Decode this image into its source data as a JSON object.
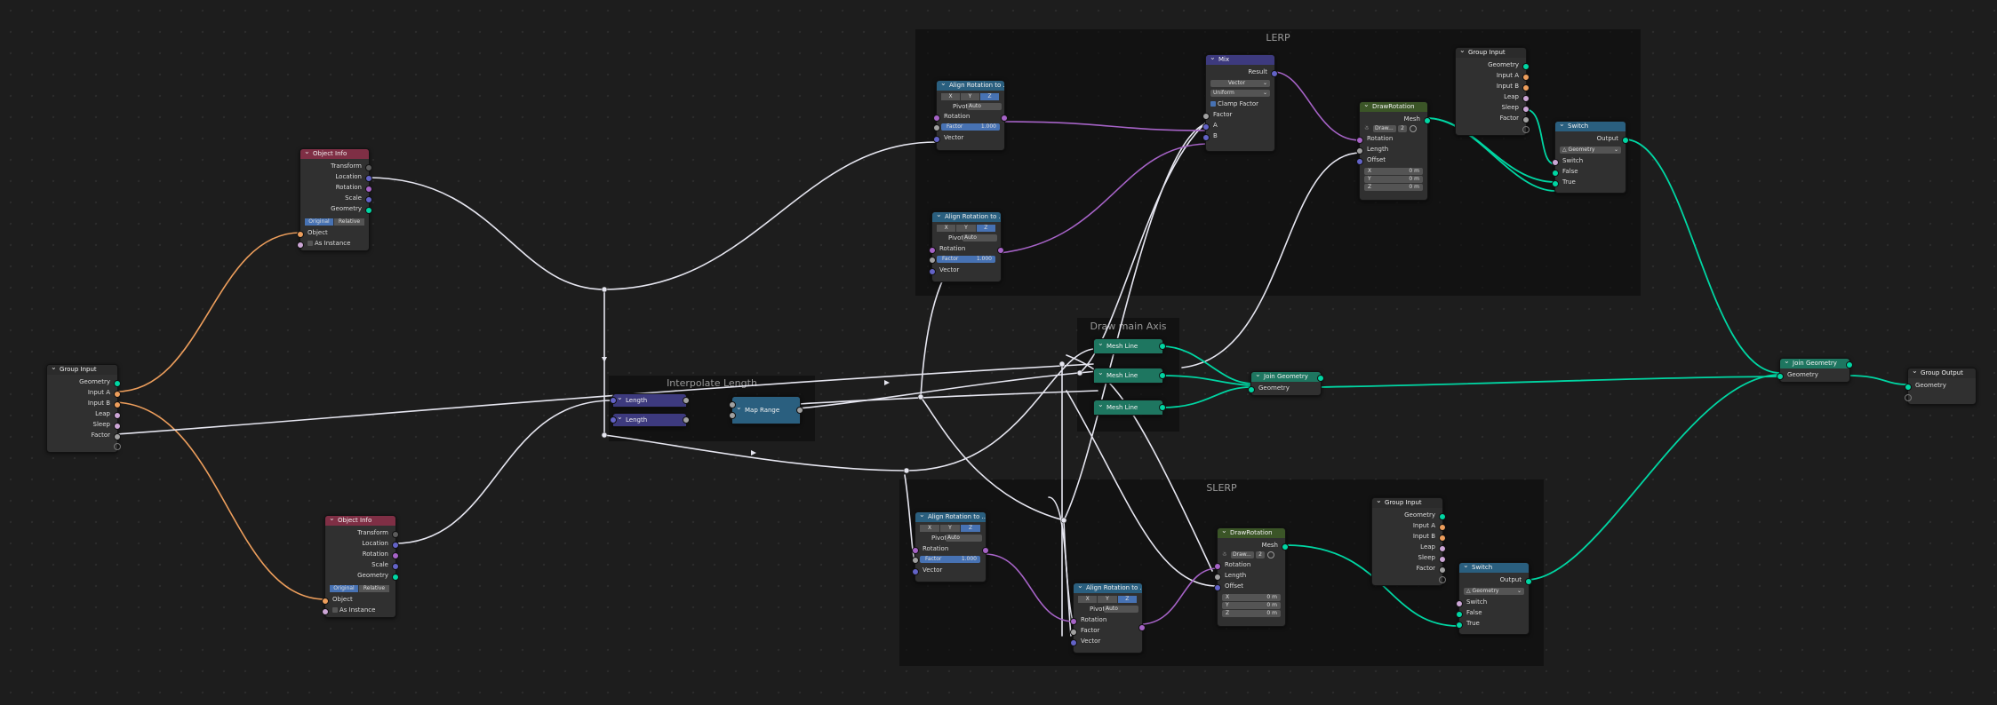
{
  "frames": {
    "lerp": "LERP",
    "slerp": "SLERP",
    "interp": "Interpolate Length",
    "axis": "Draw main Axis"
  },
  "nodes": {
    "gi_main": {
      "title": "Group Input",
      "outs": [
        "Geometry",
        "Input A",
        "Input B",
        "Leap",
        "Sleep",
        "Factor"
      ]
    },
    "oi1": {
      "title": "Object Info",
      "outs": [
        "Transform",
        "Location",
        "Rotation",
        "Scale",
        "Geometry"
      ],
      "btn1": "Original",
      "btn2": "Relative",
      "in_object": "Object",
      "as_instance": "As Instance"
    },
    "oi2": {
      "title": "Object Info",
      "outs": [
        "Transform",
        "Location",
        "Rotation",
        "Scale",
        "Geometry"
      ],
      "btn1": "Original",
      "btn2": "Relative",
      "in_object": "Object",
      "as_instance": "As Instance"
    },
    "len1": {
      "title": "Length"
    },
    "len2": {
      "title": "Length"
    },
    "maprange": {
      "title": "Map Range"
    },
    "align1": {
      "title": "Align Rotation to ...",
      "x": "X",
      "y": "Y",
      "z": "Z",
      "pivot": "Pivot",
      "pivot_val": "Auto",
      "rotation": "Rotation",
      "factor": "Factor",
      "factor_val": "1.000",
      "vector": "Vector"
    },
    "align2": {
      "title": "Align Rotation to ...",
      "x": "X",
      "y": "Y",
      "z": "Z",
      "pivot": "Pivot",
      "pivot_val": "Auto",
      "rotation": "Rotation",
      "factor": "Factor",
      "factor_val": "1.000",
      "vector": "Vector"
    },
    "align3": {
      "title": "Align Rotation to ...",
      "x": "X",
      "y": "Y",
      "z": "Z",
      "pivot": "Pivot",
      "pivot_val": "Auto",
      "rotation": "Rotation",
      "factor": "Factor",
      "factor_val": "1.000",
      "vector": "Vector"
    },
    "align4": {
      "title": "Align Rotation to ...",
      "x": "X",
      "y": "Y",
      "z": "Z",
      "pivot": "Pivot",
      "pivot_val": "Auto",
      "rotation": "Rotation",
      "factor": "Factor",
      "vector": "Vector"
    },
    "mix": {
      "title": "Mix",
      "result": "Result",
      "type": "Vector",
      "mode": "Uniform",
      "clamp": "Clamp Factor",
      "factor": "Factor",
      "a": "A",
      "b": "B"
    },
    "draw1": {
      "title": "DrawRotation",
      "mesh": "Mesh",
      "sel": "Draw...",
      "num": "2",
      "rotation": "Rotation",
      "length": "Length",
      "offset": "Offset",
      "x": "X",
      "y": "Y",
      "z": "Z",
      "xv": "0 m",
      "yv": "0 m",
      "zv": "0 m"
    },
    "draw2": {
      "title": "DrawRotation",
      "mesh": "Mesh",
      "sel": "Draw...",
      "num": "2",
      "rotation": "Rotation",
      "length": "Length",
      "offset": "Offset",
      "x": "X",
      "y": "Y",
      "z": "Z",
      "xv": "0 m",
      "yv": "0 m",
      "zv": "0 m"
    },
    "gi_top": {
      "title": "Group Input",
      "outs": [
        "Geometry",
        "Input A",
        "Input B",
        "Leap",
        "Sleep",
        "Factor"
      ]
    },
    "gi_bot": {
      "title": "Group Input",
      "outs": [
        "Geometry",
        "Input A",
        "Input B",
        "Leap",
        "Sleep",
        "Factor"
      ]
    },
    "sw1": {
      "title": "Switch",
      "output": "Output",
      "type": "Geometry",
      "switch": "Switch",
      "false": "False",
      "true": "True"
    },
    "sw2": {
      "title": "Switch",
      "output": "Output",
      "type": "Geometry",
      "switch": "Switch",
      "false": "False",
      "true": "True"
    },
    "ml1": {
      "title": "Mesh Line"
    },
    "ml2": {
      "title": "Mesh Line"
    },
    "ml3": {
      "title": "Mesh Line"
    },
    "join1": {
      "title": "Join Geometry",
      "geometry": "Geometry"
    },
    "join2": {
      "title": "Join Geometry",
      "geometry": "Geometry"
    },
    "gout": {
      "title": "Group Output",
      "geometry": "Geometry"
    }
  },
  "colors": {
    "geometry": "#00d6a3",
    "vector": "#6363c7",
    "rotation": "#a663c7",
    "float": "#a1a1a1",
    "object": "#ed9e5c"
  }
}
